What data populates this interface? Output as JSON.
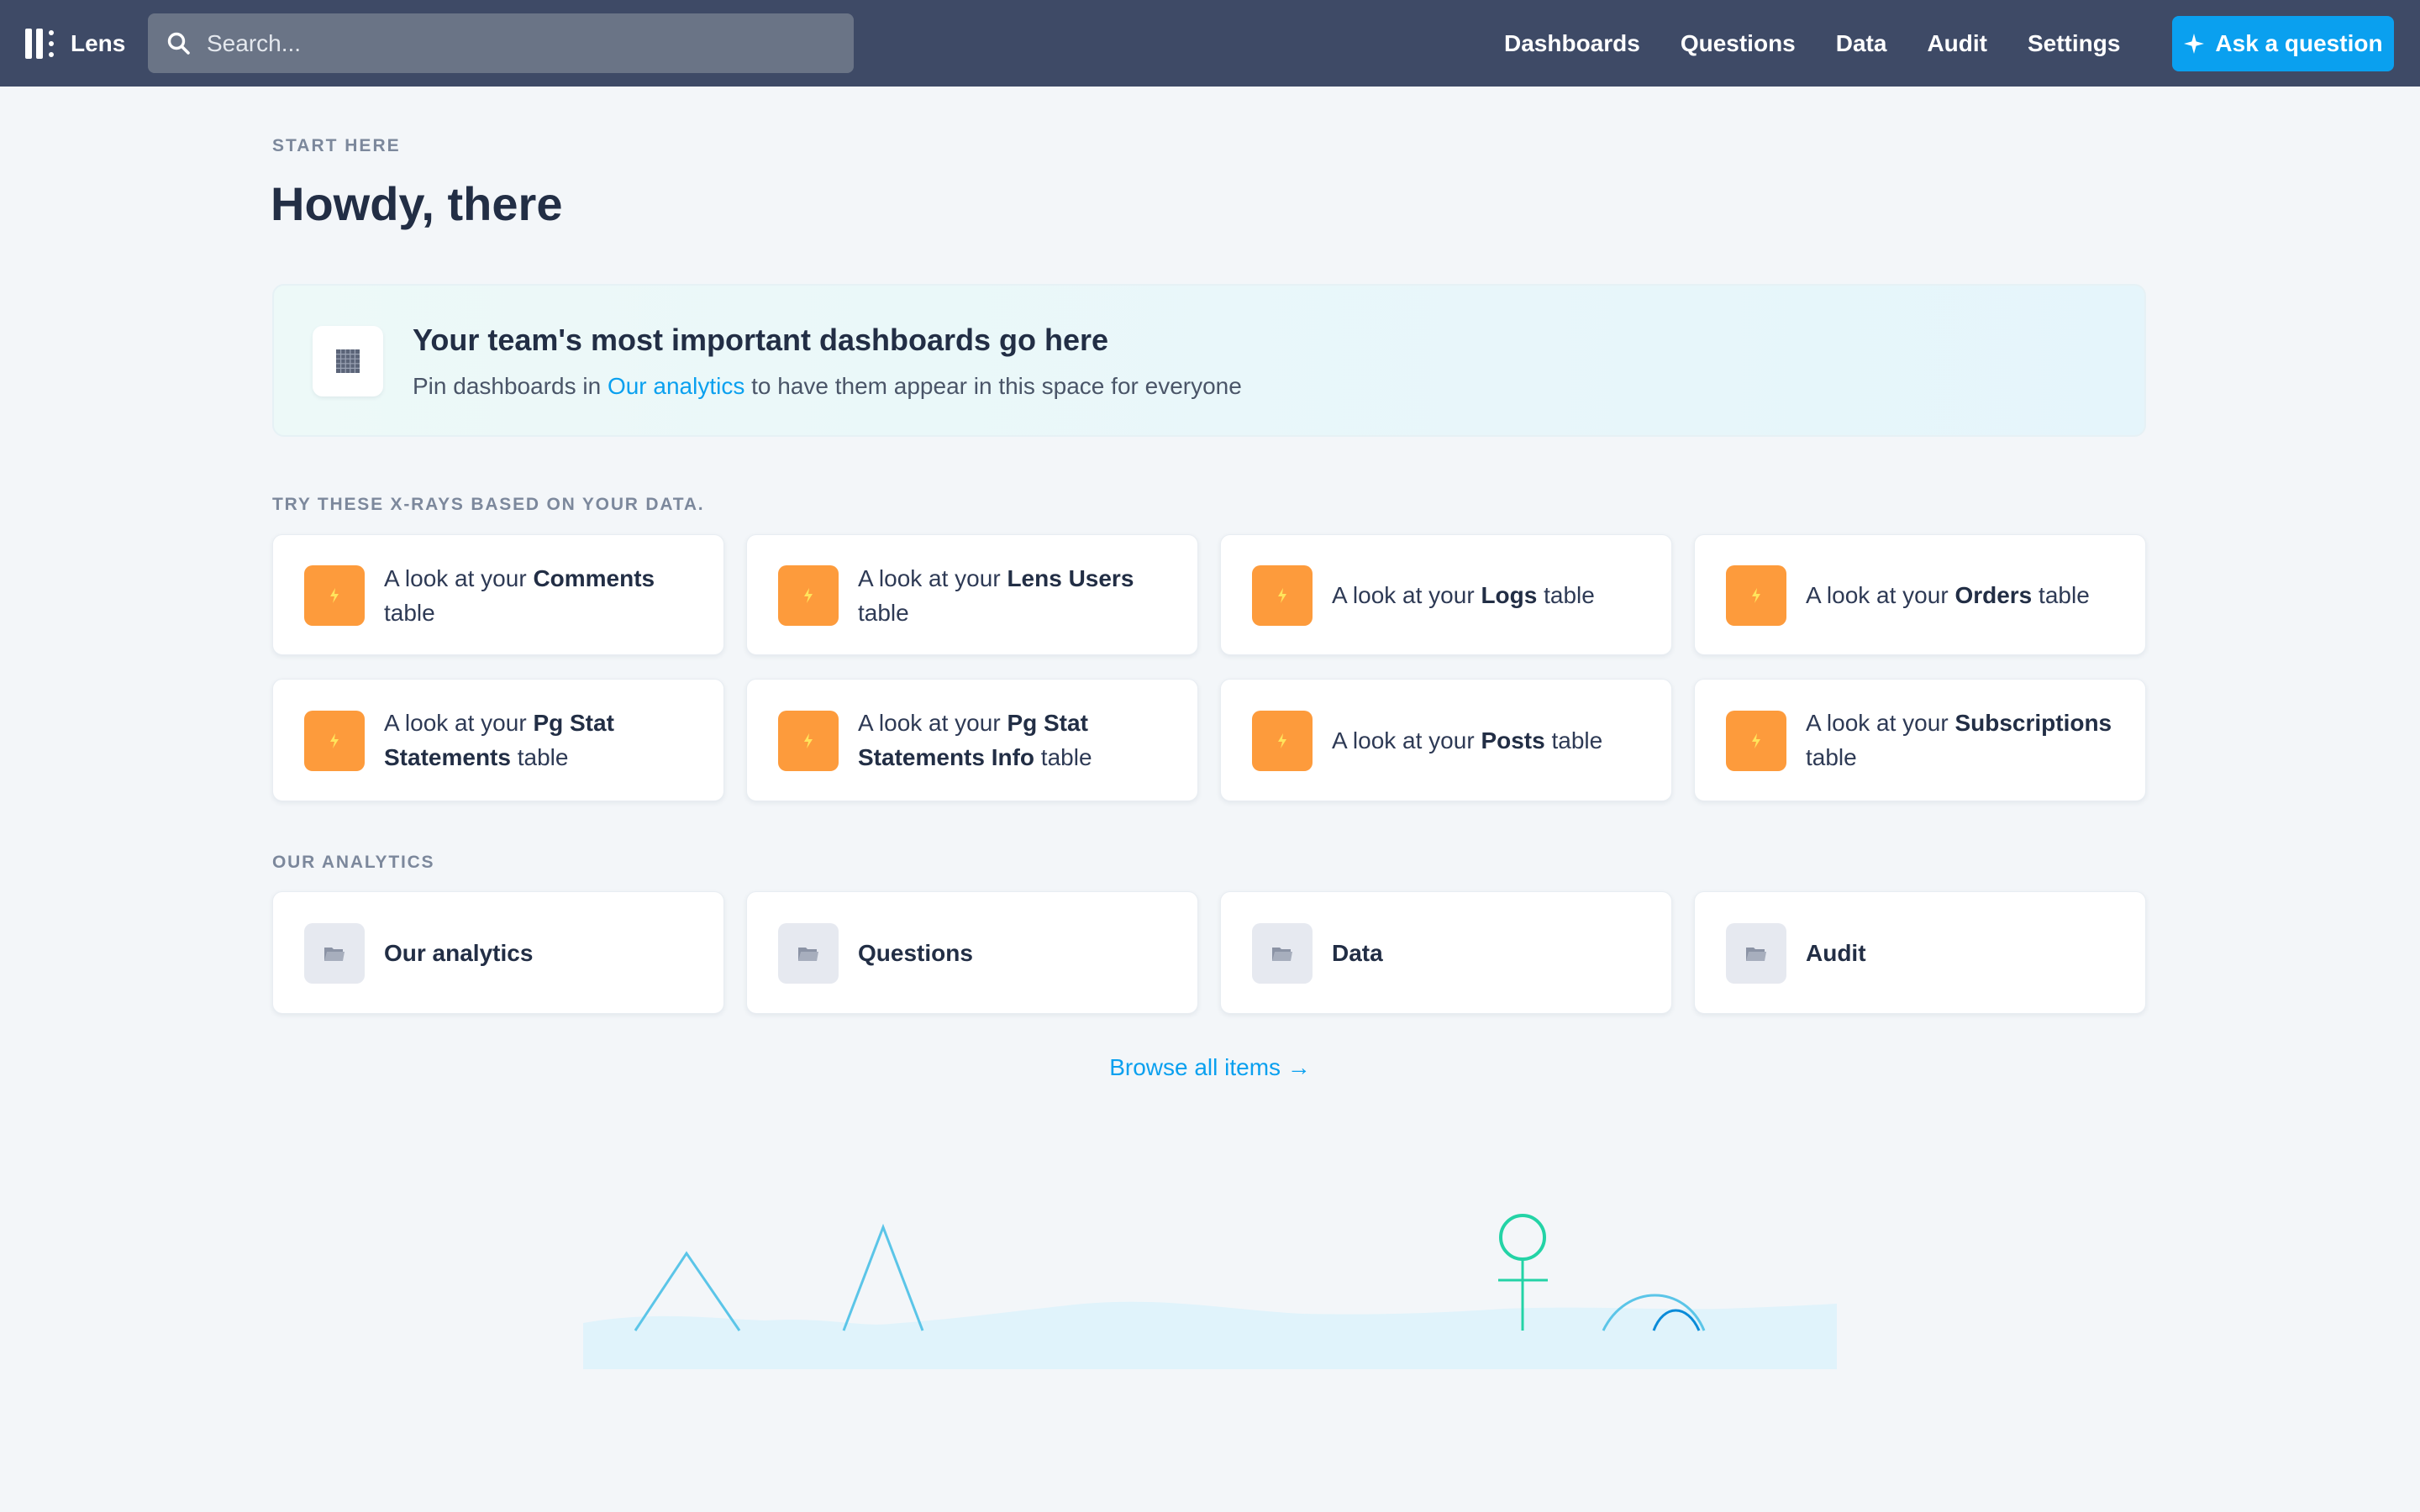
{
  "app": {
    "name": "Lens"
  },
  "search": {
    "placeholder": "Search..."
  },
  "nav": {
    "links": [
      "Dashboards",
      "Questions",
      "Data",
      "Audit",
      "Settings"
    ],
    "ask_button": "Ask a question"
  },
  "home": {
    "eyebrow": "START HERE",
    "title": "Howdy, there",
    "banner": {
      "title": "Your team's most important dashboards go here",
      "text_before": "Pin dashboards in ",
      "link": "Our analytics",
      "text_after": " to have them appear in this space for everyone"
    },
    "xrays": {
      "heading": "TRY THESE X-RAYS BASED ON YOUR DATA.",
      "prefix": "A look at your ",
      "suffix": " table",
      "items": [
        "Comments",
        "Lens Users",
        "Logs",
        "Orders",
        "Pg Stat Statements",
        "Pg Stat Statements Info",
        "Posts",
        "Subscriptions"
      ]
    },
    "analytics": {
      "heading": "OUR ANALYTICS",
      "items": [
        "Our analytics",
        "Questions",
        "Data",
        "Audit"
      ]
    },
    "browse_all": "Browse all items →"
  },
  "colors": {
    "nav_bg": "#3e4a66",
    "accent": "#0aa0ef",
    "xray_icon": "#fd9b3c",
    "page_bg": "#f3f6f9"
  },
  "icons": {
    "search": "search-icon",
    "ask": "sparkle-icon",
    "banner": "grid-icon",
    "xray": "bolt-icon",
    "collection": "folder-icon"
  }
}
